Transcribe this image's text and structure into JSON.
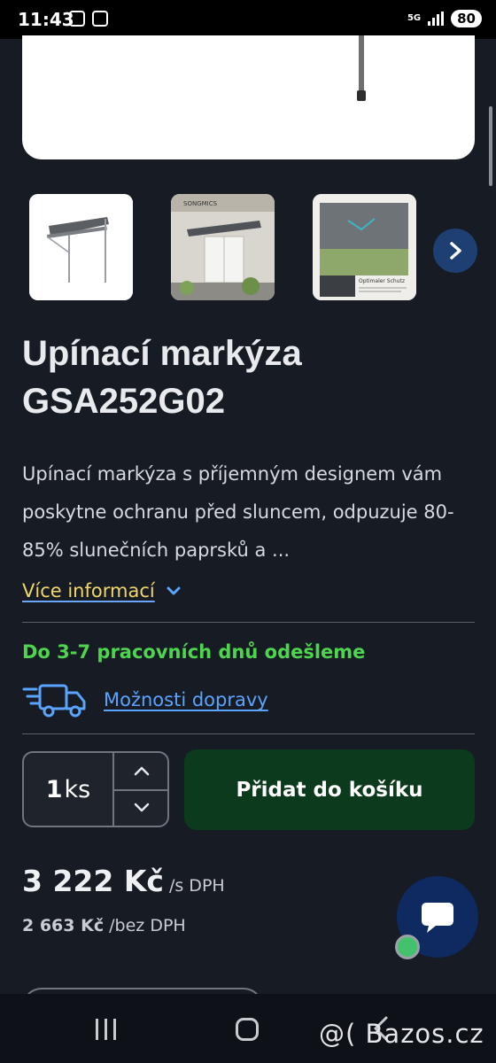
{
  "status_bar": {
    "time": "11:43",
    "network": "5G",
    "battery": "80"
  },
  "product": {
    "title": "Upínací markýza GSA252G02",
    "description": "Upínací markýza s příjemným designem vám poskytne ochranu před sluncem, odpuzuje 80-85% slunečních paprsků a ...",
    "more_info": "Více informací",
    "shipping_time": "Do 3-7 pracovních dnů odešleme",
    "delivery_options": "Možnosti dopravy"
  },
  "thumbnails": [
    {
      "alt": "markýza na bílém pozadí"
    },
    {
      "alt": "markýza nad dveřmi",
      "brand_text": "SONGMICS"
    },
    {
      "alt": "detail látky",
      "caption": "Optimaler Schutz"
    }
  ],
  "purchase": {
    "quantity": "1",
    "unit": "ks",
    "add_to_cart": "Přidat do košíku"
  },
  "pricing": {
    "price_with_vat": "3 222 Kč",
    "with_vat_suffix": "/s DPH",
    "price_without_vat": "2 663 Kč",
    "without_vat_suffix": "/bez DPH"
  },
  "watermark": "@( Bazos.cz",
  "colors": {
    "background": "#161b24",
    "accent_green": "#4ed44e",
    "link_blue": "#5aa4ff",
    "link_yellow": "#f1d66b",
    "cart_button": "#0b3a1c",
    "chat_button": "#0f2a60"
  }
}
